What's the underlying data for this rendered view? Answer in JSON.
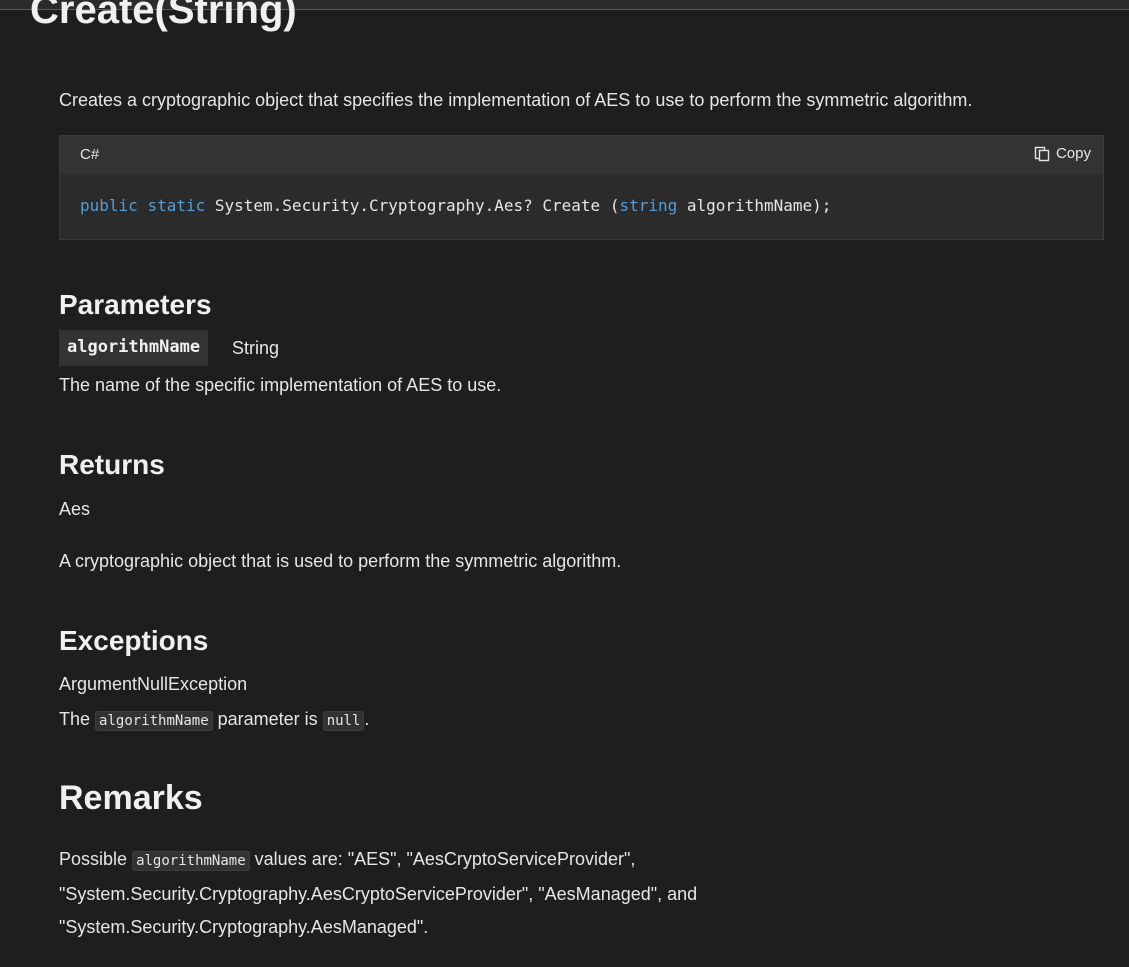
{
  "title": "Create(String)",
  "summary": "Creates a cryptographic object that specifies the implementation of AES to use to perform the symmetric algorithm.",
  "code": {
    "language": "C#",
    "copy_label": "Copy",
    "kw_public": "public",
    "kw_static": "static",
    "type_part": " System.Security.Cryptography.Aes? Create (",
    "kw_string": "string",
    "param_part": " algorithmName);"
  },
  "parameters": {
    "heading": "Parameters",
    "name": "algorithmName",
    "type_link": "String",
    "description": "The name of the specific implementation of AES to use."
  },
  "returns": {
    "heading": "Returns",
    "type_link": "Aes",
    "description": "A cryptographic object that is used to perform the symmetric algorithm."
  },
  "exceptions": {
    "heading": "Exceptions",
    "type_link": "ArgumentNullException",
    "desc_prefix": "The",
    "desc_code1": "algorithmName",
    "desc_middle": "parameter is",
    "desc_code2": "null",
    "desc_suffix": "."
  },
  "remarks": {
    "heading": "Remarks",
    "prefix": "Possible",
    "code": "algorithmName",
    "line1_rest": "values are: \"AES\", \"AesCryptoServiceProvider\",",
    "line2": "\"System.Security.Cryptography.AesCryptoServiceProvider\", \"AesManaged\", and",
    "line3": "\"System.Security.Cryptography.AesManaged\"."
  }
}
